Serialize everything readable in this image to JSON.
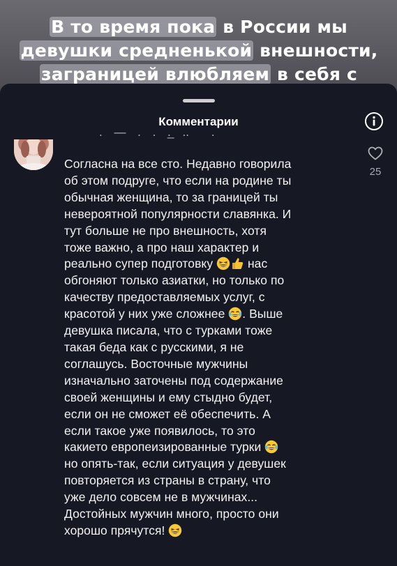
{
  "video": {
    "caption_lines": [
      {
        "parts": [
          {
            "text": "В то время пока",
            "hl": true
          },
          {
            "text": " в России мы",
            "hl": false
          }
        ]
      },
      {
        "parts": [
          {
            "text": "девушки средненькой",
            "hl": true
          },
          {
            "text": " внешности,",
            "hl": false
          }
        ]
      },
      {
        "parts": [
          {
            "text": "заграницей влюбляем",
            "hl": true
          },
          {
            "text": " в себя с",
            "hl": false
          }
        ]
      }
    ]
  },
  "sheet": {
    "title": "Комментарии",
    "info_icon": "info-icon"
  },
  "comment": {
    "like_count": "25",
    "heart_icon": "heart-outline-icon",
    "lines": [
      [
        {
          "t": "Согласна на все сто. Недавно говорила"
        }
      ],
      [
        {
          "t": "об этом подруге, что если на родине ты"
        }
      ],
      [
        {
          "t": "обычная женщина, то за границей ты"
        }
      ],
      [
        {
          "t": "невероятной популярности славянка. И"
        }
      ],
      [
        {
          "t": "тут больше не про внешность, хотя"
        }
      ],
      [
        {
          "t": "тоже важно, а про наш характер и"
        }
      ],
      [
        {
          "t": "реально супер подготовку "
        },
        {
          "e": "grin"
        },
        {
          "e": "thumb"
        },
        {
          "t": " нас"
        }
      ],
      [
        {
          "t": "обгоняют только азиатки, но только по"
        }
      ],
      [
        {
          "t": "качеству предоставляемых услуг, с"
        }
      ],
      [
        {
          "t": "красотой у них уже сложнее "
        },
        {
          "e": "laugh"
        },
        {
          "t": ". Выше"
        }
      ],
      [
        {
          "t": "девушка писала, что с турками тоже"
        }
      ],
      [
        {
          "t": "такая беда как с русскими, я не"
        }
      ],
      [
        {
          "t": "соглашусь. Восточные мужчины"
        }
      ],
      [
        {
          "t": "изначально заточены под содержание"
        }
      ],
      [
        {
          "t": "своей женщины и ему стыдно будет,"
        }
      ],
      [
        {
          "t": "если он не сможет её обеспечить. А"
        }
      ],
      [
        {
          "t": "если такое уже появилось, то это"
        }
      ],
      [
        {
          "t": "какието европеизированные турки "
        },
        {
          "e": "laugh"
        }
      ],
      [
        {
          "t": "но опять-так, если ситуация у девушек"
        }
      ],
      [
        {
          "t": "повторяется из страны в страну, что"
        }
      ],
      [
        {
          "t": "уже дело совсем не в мужчинах..."
        }
      ],
      [
        {
          "t": "Достойных мужчин много, просто они"
        }
      ],
      [
        {
          "t": "хорошо прячутся! "
        },
        {
          "e": "grin"
        }
      ]
    ]
  },
  "emoji_names": {
    "grin": "grinning-squinting-emoji",
    "laugh": "tears-of-joy-emoji",
    "thumb": "thumbs-up-emoji"
  }
}
